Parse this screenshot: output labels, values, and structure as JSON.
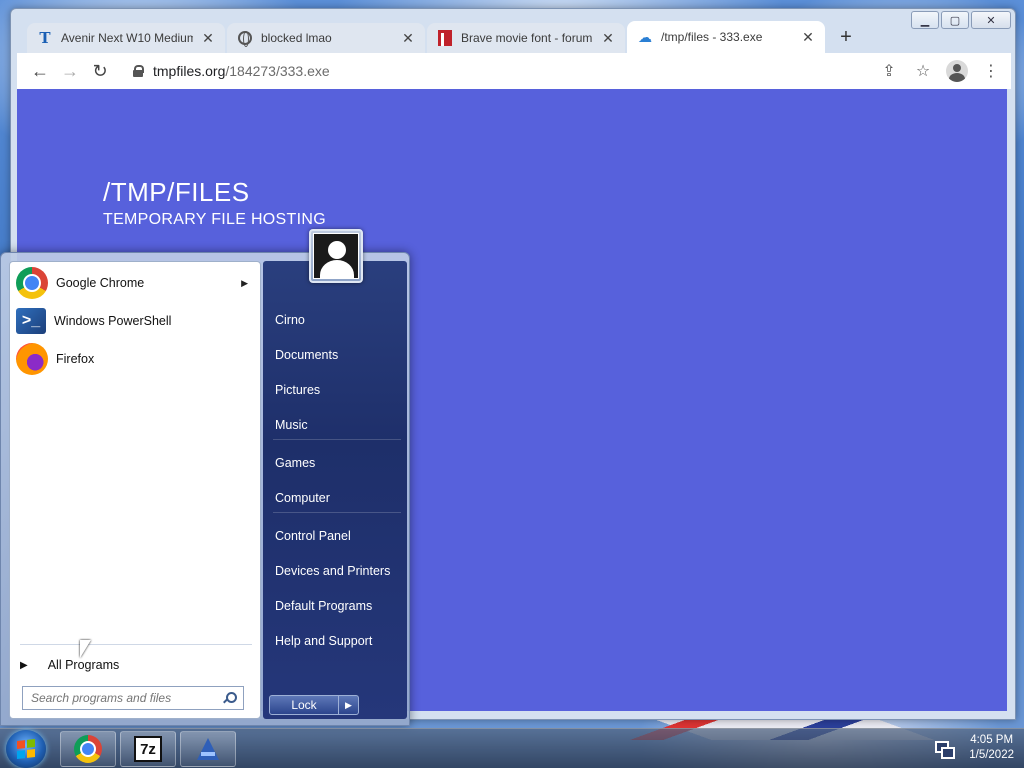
{
  "browser": {
    "tabs": [
      {
        "title": "Avenir Next W10 Medium",
        "icon": "t-favicon",
        "active": false
      },
      {
        "title": "blocked lmao",
        "icon": "globe-favicon",
        "active": false
      },
      {
        "title": "Brave movie font - forum",
        "icon": "red-favicon",
        "active": false
      },
      {
        "title": "/tmp/files - 333.exe",
        "icon": "cloud-favicon",
        "active": true
      }
    ],
    "new_tab": "+",
    "url": {
      "host": "tmpfiles.org",
      "path": "/184273/333.exe"
    },
    "window_controls": {
      "minimize": "▁",
      "maximize": "▢",
      "close": "✕"
    }
  },
  "page": {
    "title": "/TMP/FILES",
    "subtitle": "TEMPORARY FILE HOSTING",
    "background": "#5761dc"
  },
  "start_menu": {
    "pinned": [
      {
        "label": "Google Chrome",
        "icon": "chrome-icon",
        "has_submenu": true
      },
      {
        "label": "Windows PowerShell",
        "icon": "powershell-icon",
        "has_submenu": false
      },
      {
        "label": "Firefox",
        "icon": "firefox-icon",
        "has_submenu": false
      }
    ],
    "all_programs": "All Programs",
    "search_placeholder": "Search programs and files",
    "right_links": [
      {
        "label": "Cirno"
      },
      {
        "label": "Documents"
      },
      {
        "label": "Pictures"
      },
      {
        "label": "Music"
      },
      {
        "label": "Games"
      },
      {
        "label": "Computer"
      },
      {
        "label": "Control Panel"
      },
      {
        "label": "Devices and Printers"
      },
      {
        "label": "Default Programs"
      },
      {
        "label": "Help and Support"
      }
    ],
    "lock_label": "Lock",
    "lock_arrow": "▶"
  },
  "taskbar": {
    "apps": [
      {
        "name": "Google Chrome",
        "icon": "chrome-icon"
      },
      {
        "name": "7-Zip",
        "icon": "7zip-icon",
        "glyph": "7z"
      },
      {
        "name": "App",
        "icon": "app-icon"
      }
    ],
    "clock": {
      "time": "4:05 PM",
      "date": "1/5/2022"
    }
  }
}
